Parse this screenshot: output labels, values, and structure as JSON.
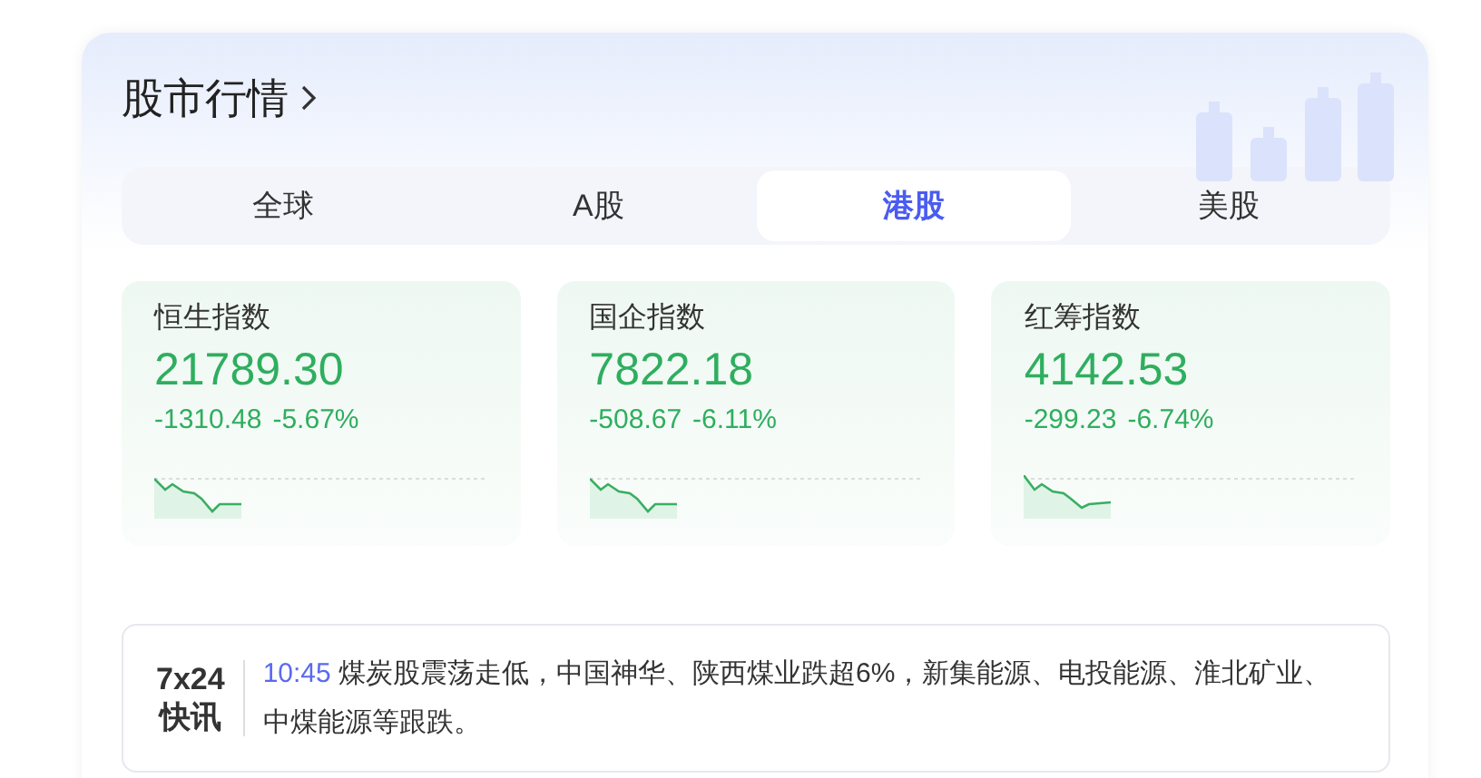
{
  "title": "股市行情",
  "tabs": [
    {
      "label": "全球",
      "selected": false
    },
    {
      "label": "A股",
      "selected": false
    },
    {
      "label": "港股",
      "selected": true
    },
    {
      "label": "美股",
      "selected": false
    }
  ],
  "indices": [
    {
      "name": "恒生指数",
      "value": "21789.30",
      "change": "-1310.48",
      "percent": "-5.67%"
    },
    {
      "name": "国企指数",
      "value": "7822.18",
      "change": "-508.67",
      "percent": "-6.11%"
    },
    {
      "name": "红筹指数",
      "value": "4142.53",
      "change": "-299.23",
      "percent": "-6.74%"
    }
  ],
  "news": {
    "badge_top": "7x24",
    "badge_bottom": "快讯",
    "time": "10:45",
    "text": "煤炭股震荡走低，中国神华、陕西煤业跌超6%，新集能源、电投能源、淮北矿业、中煤能源等跟跌。"
  }
}
